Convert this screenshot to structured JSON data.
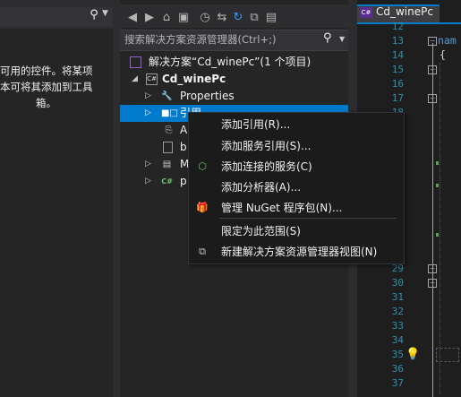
{
  "toolbox": {
    "search_icon": "search-icon",
    "message_lines": [
      "可用的控件。将某项",
      "本可将其添加到工具",
      "箱。"
    ]
  },
  "solution_explorer": {
    "toolbar_icons": [
      "back-icon",
      "forward-icon",
      "home-icon",
      "switch-views-icon",
      "history-icon",
      "sync-icon",
      "refresh-icon",
      "collapse-all-icon",
      "show-all-files-icon"
    ],
    "search_placeholder": "搜索解决方案资源管理器(Ctrl+;)",
    "tree": [
      {
        "label": "解决方案“Cd_winePc”(1 个项目)",
        "icon": "solution-icon",
        "expanded": null
      },
      {
        "label": "Cd_winePc",
        "icon": "csharp-project-icon",
        "expanded": true
      },
      {
        "label": "Properties",
        "icon": "wrench-icon",
        "expanded": false
      },
      {
        "label": "引用",
        "icon": "references-icon",
        "expanded": false,
        "selected": true
      },
      {
        "label": "A",
        "icon": "config-file-icon",
        "expanded": null
      },
      {
        "label": "b",
        "icon": "file-icon",
        "expanded": null
      },
      {
        "label": "M",
        "icon": "form-icon",
        "expanded": false
      },
      {
        "label": "p",
        "icon": "csharp-file-icon",
        "expanded": false
      }
    ]
  },
  "editor": {
    "tab_label": "Cd_winePc",
    "tab_icon_text": "C#",
    "line_numbers_top": [
      "12",
      "13",
      "14",
      "15",
      "16",
      "17",
      "18"
    ],
    "line_numbers_bottom": [
      "29",
      "30",
      "31",
      "32",
      "33",
      "34",
      "35",
      "36",
      "37"
    ],
    "code_line_1": "nam",
    "code_line_2": "{"
  },
  "context_menu": {
    "items": [
      {
        "label": "添加引用(R)...",
        "icon": null
      },
      {
        "label": "添加服务引用(S)...",
        "icon": null
      },
      {
        "label": "添加连接的服务(C)",
        "icon": "connected-service-icon"
      },
      {
        "label": "添加分析器(A)...",
        "icon": null
      },
      {
        "label": "管理 NuGet 程序包(N)...",
        "icon": "nuget-package-icon"
      },
      {
        "label": "限定为此范围(S)",
        "icon": null
      },
      {
        "label": "新建解决方案资源管理器视图(N)",
        "icon": "new-view-icon"
      }
    ]
  },
  "colors": {
    "selection": "#007acc",
    "panel_bg": "#252526",
    "chrome_bg": "#2d2d30",
    "menu_bg": "#1b1b1c",
    "line_number": "#2b91af"
  }
}
